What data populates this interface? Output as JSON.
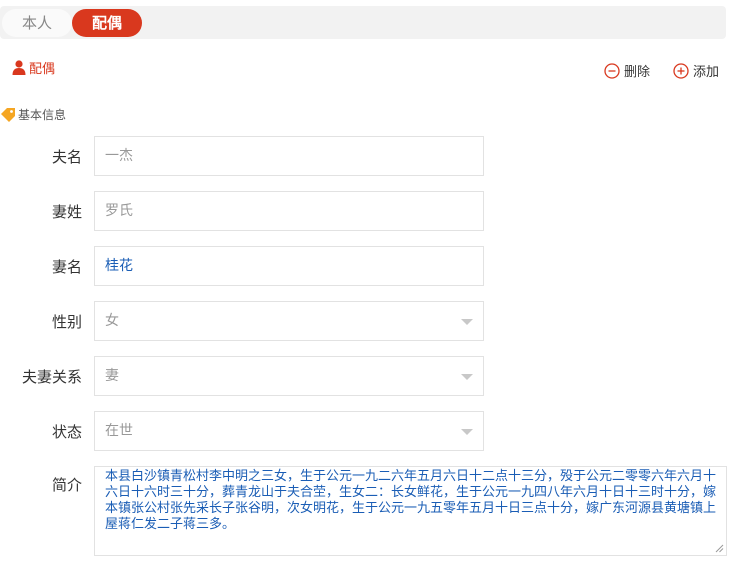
{
  "tabs": [
    {
      "label": "本人",
      "active": false
    },
    {
      "label": "配偶",
      "active": true
    }
  ],
  "person": {
    "label": "配偶",
    "icon": "person-icon"
  },
  "actions": {
    "delete_label": "删除",
    "add_label": "添加"
  },
  "section": {
    "label": "基本信息",
    "icon": "tag-icon"
  },
  "form": {
    "husband_name": {
      "label": "夫名",
      "placeholder": "一杰"
    },
    "wife_surname": {
      "label": "妻姓",
      "placeholder": "罗氏"
    },
    "wife_name": {
      "label": "妻名",
      "value": "桂花"
    },
    "gender": {
      "label": "性别",
      "value": "女"
    },
    "relation": {
      "label": "夫妻关系",
      "value": "妻"
    },
    "status": {
      "label": "状态",
      "value": "在世"
    },
    "intro": {
      "label": "简介",
      "value": "本县白沙镇青松村李中明之三女，生于公元一九二六年五月六日十二点十三分，殁于公元二零零六年六月十六日十六时三十分，葬青龙山于夫合茔，生女二：长女鲜花，生于公元一九四八年六月十日十三时十分，嫁本镇张公村张先采长子张谷明，次女明花，生于公元一九五零年五月十日三点十分，嫁广东河源县黄塘镇上屋蒋仁发二子蒋三多。"
    }
  },
  "colors": {
    "accent": "#d9381e",
    "value_text": "#1a5db5",
    "placeholder": "#999999",
    "tag": "#f5a623"
  }
}
